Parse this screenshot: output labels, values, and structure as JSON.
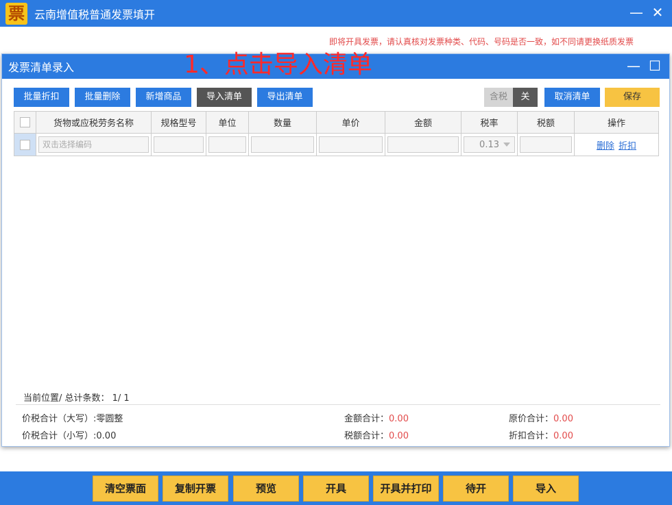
{
  "app": {
    "title": "云南增值税普通发票填开",
    "logo_char": "票"
  },
  "notice": "即将开具发票，请认真核对发票种类、代码、号码是否一致，如不同请更换纸质发票",
  "dialog": {
    "title": "发票清单录入",
    "annotation": "1、点击导入清单",
    "toolbar": {
      "batch_discount": "批量折扣",
      "batch_delete": "批量删除",
      "add_item": "新增商品",
      "import_list": "导入清单",
      "export_list": "导出清单",
      "tax_included_label": "含税",
      "tax_toggle_state": "关",
      "cancel_list": "取消清单",
      "save": "保存"
    },
    "table": {
      "headers": [
        "货物或应税劳务名称",
        "规格型号",
        "单位",
        "数量",
        "单价",
        "金额",
        "税率",
        "税额",
        "操作"
      ],
      "row": {
        "name_placeholder": "双击选择编码",
        "tax_rate": "0.13",
        "delete_link": "删除",
        "discount_link": "折扣"
      }
    },
    "position_text": "当前位置/ 总计条数：  1/ 1",
    "totals": {
      "total_upper_label": "价税合计（大写）:",
      "total_upper_value": "零圆整",
      "total_lower_label": "价税合计（小写）:",
      "total_lower_value": "0.00",
      "amount_label": "金额合计：",
      "amount_value": "0.00",
      "tax_label": "税额合计：",
      "tax_value": "0.00",
      "original_label": "原价合计：",
      "original_value": "0.00",
      "discount_label": "折扣合计：",
      "discount_value": "0.00"
    }
  },
  "bottom_buttons": [
    "清空票面",
    "复制开票",
    "预览",
    "开具",
    "开具并打印",
    "待开",
    "导入"
  ]
}
